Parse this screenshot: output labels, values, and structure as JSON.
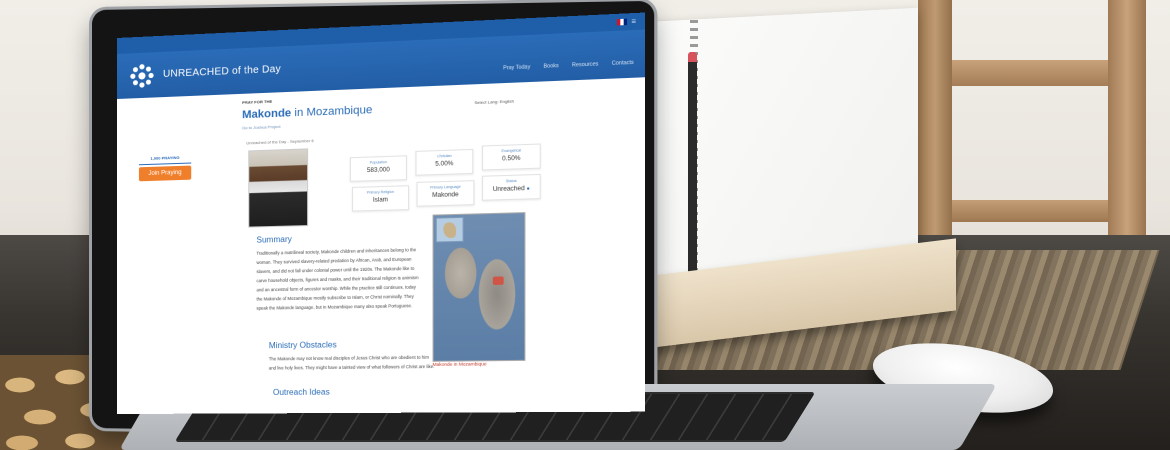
{
  "scene": {
    "description_items": [
      "laptop",
      "notebook",
      "pen",
      "wireless-mouse",
      "wooden-shelf",
      "wood-coasters"
    ]
  },
  "website": {
    "site_title": "UNREACHED of the Day",
    "nav": [
      "Pray Today",
      "Books",
      "Resources",
      "Contacts"
    ],
    "select_language": "Select Lang: English",
    "pray_for_label": "PRAY FOR THE",
    "people_name": "Makonde",
    "people_country": " in Mozambique",
    "joshua_link": "Go to Joshua Project",
    "date_line": "Unreached of the Day - September 6",
    "sidebar": {
      "pray_button": "1,000 PRAYING",
      "join_button": "Join Praying"
    },
    "stats": [
      {
        "label": "Population",
        "value": "583,000"
      },
      {
        "label": "Christian",
        "value": "5.00%"
      },
      {
        "label": "Evangelical",
        "value": "0.50%"
      },
      {
        "label": "Primary Religion",
        "value": "Islam"
      },
      {
        "label": "Primary Language",
        "value": "Makonde"
      },
      {
        "label": "Status",
        "value": "Unreached"
      }
    ],
    "summary_heading": "Summary",
    "summary_text": "Traditionally a matrilineal society, Makonde children and inheritances belong to the woman. They survived slavery-related predation by African, Arab, and European slavers, and did not fall under colonial power until the 1920s. The Makonde like to carve household objects, figures and masks, and their traditional religion is animism and an ancestral form of ancestor worship. While the practice still continues, today the Makonde of Mozambique mostly subscribe to Islam, or Christ nominally. They speak the Makonde language, but in Mozambique many also speak Portuguese.",
    "obstacles_heading": "Ministry Obstacles",
    "obstacles_text": "The Makonde may not know real disciples of Jesus Christ who are obedient to him and live holy lives. They might have a tainted view of what followers of Christ are like.",
    "outreach_heading": "Outreach Ideas",
    "map_caption": "Makonde in Mozambique"
  },
  "colors": {
    "brand_blue": "#2b6cb8",
    "join_orange": "#f07f2c",
    "link_red": "#c0392b"
  }
}
